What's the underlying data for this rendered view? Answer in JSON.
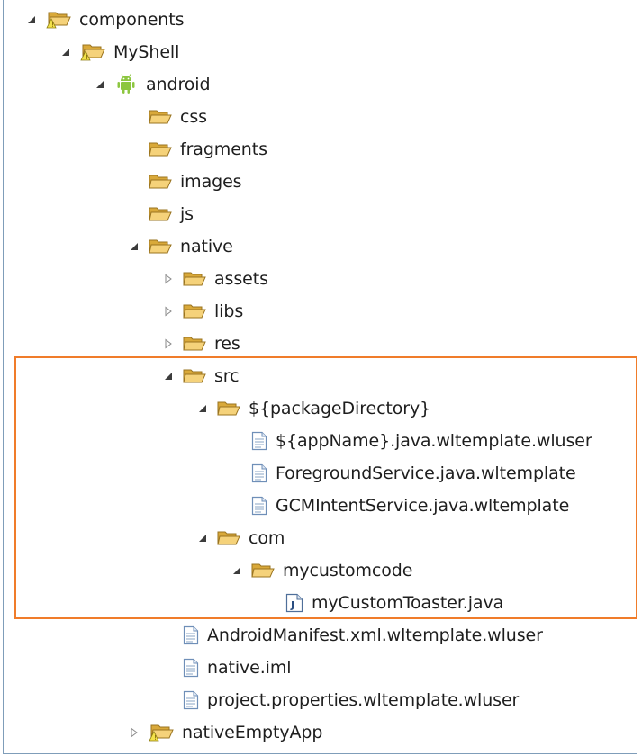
{
  "tree": {
    "items": [
      {
        "label": "components",
        "level": 0,
        "twisty": "expanded",
        "icon": "project-folder-icon"
      },
      {
        "label": "MyShell",
        "level": 1,
        "twisty": "expanded",
        "icon": "project-folder-icon"
      },
      {
        "label": "android",
        "level": 2,
        "twisty": "expanded",
        "icon": "android-icon"
      },
      {
        "label": "css",
        "level": 3,
        "twisty": "none",
        "icon": "folder-icon"
      },
      {
        "label": "fragments",
        "level": 3,
        "twisty": "none",
        "icon": "folder-icon"
      },
      {
        "label": "images",
        "level": 3,
        "twisty": "none",
        "icon": "folder-icon"
      },
      {
        "label": "js",
        "level": 3,
        "twisty": "none",
        "icon": "folder-icon"
      },
      {
        "label": "native",
        "level": 3,
        "twisty": "expanded",
        "icon": "folder-icon"
      },
      {
        "label": "assets",
        "level": 4,
        "twisty": "collapsed",
        "icon": "folder-icon"
      },
      {
        "label": "libs",
        "level": 4,
        "twisty": "collapsed",
        "icon": "folder-icon"
      },
      {
        "label": "res",
        "level": 4,
        "twisty": "collapsed",
        "icon": "folder-icon"
      },
      {
        "label": "src",
        "level": 4,
        "twisty": "expanded",
        "icon": "folder-icon"
      },
      {
        "label": "${packageDirectory}",
        "level": 5,
        "twisty": "expanded",
        "icon": "folder-icon"
      },
      {
        "label": "${appName}.java.wltemplate.wluser",
        "level": 6,
        "twisty": "none",
        "icon": "file-icon"
      },
      {
        "label": "ForegroundService.java.wltemplate",
        "level": 6,
        "twisty": "none",
        "icon": "file-icon"
      },
      {
        "label": "GCMIntentService.java.wltemplate",
        "level": 6,
        "twisty": "none",
        "icon": "file-icon"
      },
      {
        "label": "com",
        "level": 5,
        "twisty": "expanded",
        "icon": "folder-icon"
      },
      {
        "label": "mycustomcode",
        "level": 6,
        "twisty": "expanded",
        "icon": "folder-icon"
      },
      {
        "label": "myCustomToaster.java",
        "level": 7,
        "twisty": "none",
        "icon": "java-file-icon"
      },
      {
        "label": "AndroidManifest.xml.wltemplate.wluser",
        "level": 4,
        "twisty": "none",
        "icon": "file-icon"
      },
      {
        "label": "native.iml",
        "level": 4,
        "twisty": "none",
        "icon": "file-icon"
      },
      {
        "label": "project.properties.wltemplate.wluser",
        "level": 4,
        "twisty": "none",
        "icon": "file-icon"
      },
      {
        "label": "nativeEmptyApp",
        "level": 3,
        "twisty": "collapsed",
        "icon": "project-folder-icon"
      }
    ]
  },
  "colors": {
    "highlight_border": "#f07c2a",
    "folder": "#e8b84a",
    "android": "#8cc63f",
    "file": "#6f8fb8"
  }
}
